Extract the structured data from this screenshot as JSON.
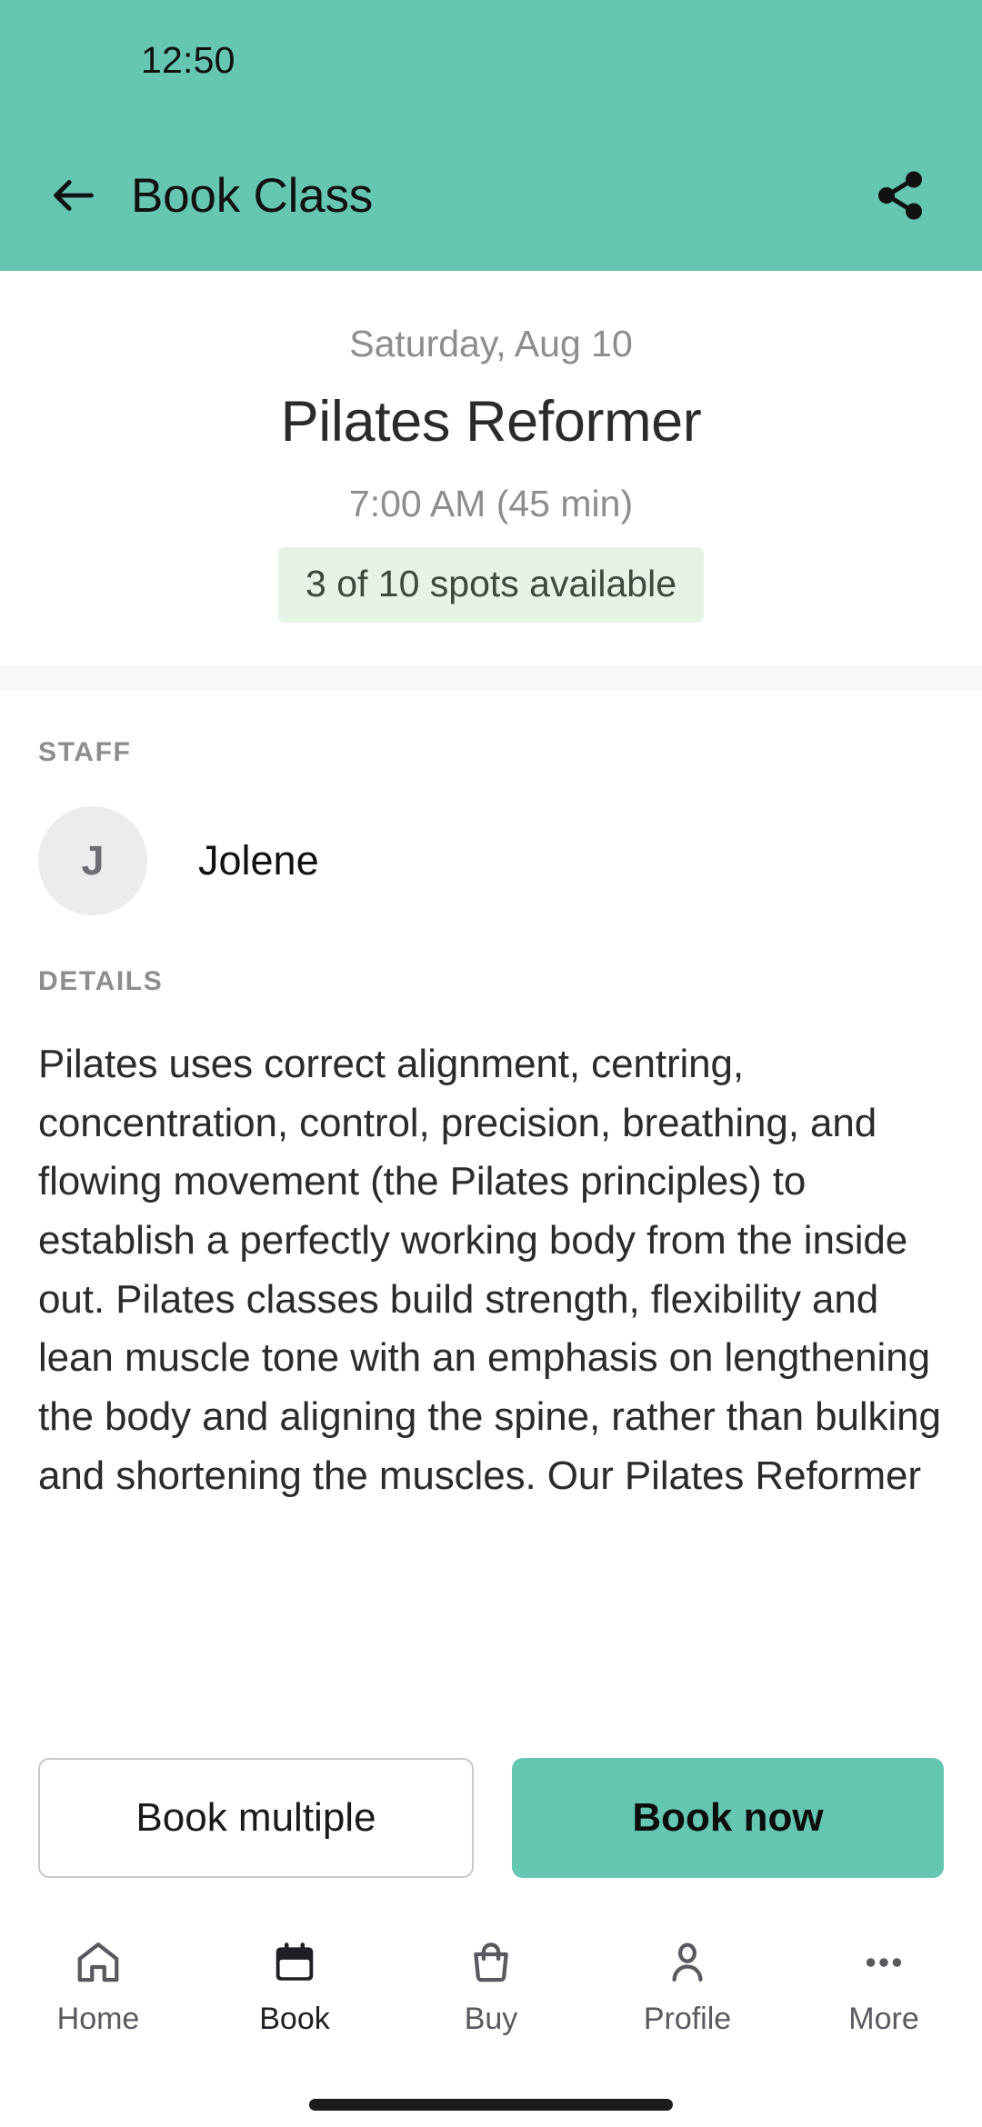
{
  "status_bar": {
    "time": "12:50"
  },
  "app_bar": {
    "title": "Book Class",
    "back_icon": "arrow-left-icon",
    "share_icon": "share-icon"
  },
  "class_header": {
    "date": "Saturday, Aug 10",
    "name": "Pilates Reformer",
    "time": "7:00 AM (45 min)",
    "spots": "3 of 10 spots available"
  },
  "staff": {
    "label": "STAFF",
    "avatar_initial": "J",
    "name": "Jolene"
  },
  "details": {
    "label": "DETAILS",
    "text": "Pilates uses correct alignment, centring, concentration, control, precision, breathing, and flowing movement (the Pilates principles) to establish a perfectly working body from the inside out. Pilates classes build strength, flexibility and lean muscle tone with an emphasis on lengthening the body and aligning the spine, rather than bulking and shortening the muscles. Our Pilates Reformer"
  },
  "actions": {
    "secondary_label": "Book multiple",
    "primary_label": "Book now"
  },
  "bottom_nav": {
    "items": [
      {
        "label": "Home",
        "icon": "home-icon",
        "active": false
      },
      {
        "label": "Book",
        "icon": "calendar-icon",
        "active": true
      },
      {
        "label": "Buy",
        "icon": "shopping-bag-icon",
        "active": false
      },
      {
        "label": "Profile",
        "icon": "person-icon",
        "active": false
      },
      {
        "label": "More",
        "icon": "ellipsis-icon",
        "active": false
      }
    ]
  },
  "colors": {
    "brand_teal": "#65c6b2",
    "badge_background": "#e6f4e6",
    "muted_text": "#8d8d8d"
  }
}
